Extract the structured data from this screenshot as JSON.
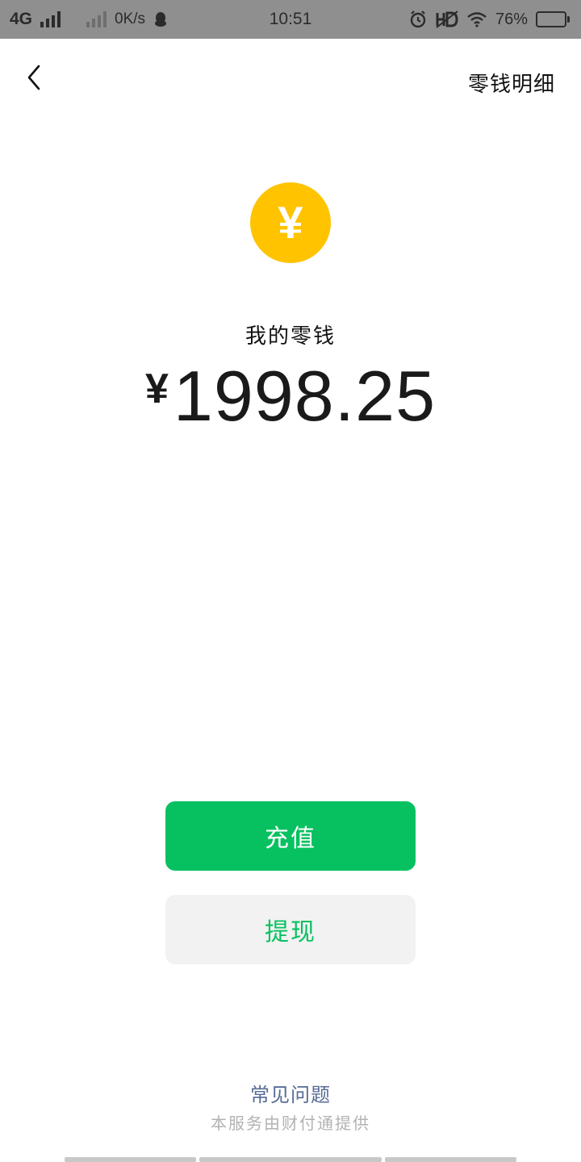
{
  "status_bar": {
    "network": "4G",
    "speed": "0K/s",
    "time": "10:51",
    "battery_percent": "76%",
    "battery_level": 0.76,
    "icons": [
      "signal-icon",
      "signal-icon",
      "qq-icon",
      "alarm-icon",
      "hd-icon",
      "wifi-icon",
      "battery-icon"
    ]
  },
  "header": {
    "back_icon": "chevron-left-icon",
    "detail_link": "零钱明细"
  },
  "balance": {
    "coin_symbol": "¥",
    "label": "我的零钱",
    "currency": "¥",
    "amount": "1998.25"
  },
  "actions": {
    "recharge": "充值",
    "withdraw": "提现"
  },
  "footer": {
    "faq": "常见问题",
    "provider": "本服务由财付通提供"
  },
  "colors": {
    "accent_green": "#07c160",
    "coin_yellow": "#ffc300",
    "link_blue": "#576b95",
    "status_bar_bg": "#8f8f8f"
  }
}
